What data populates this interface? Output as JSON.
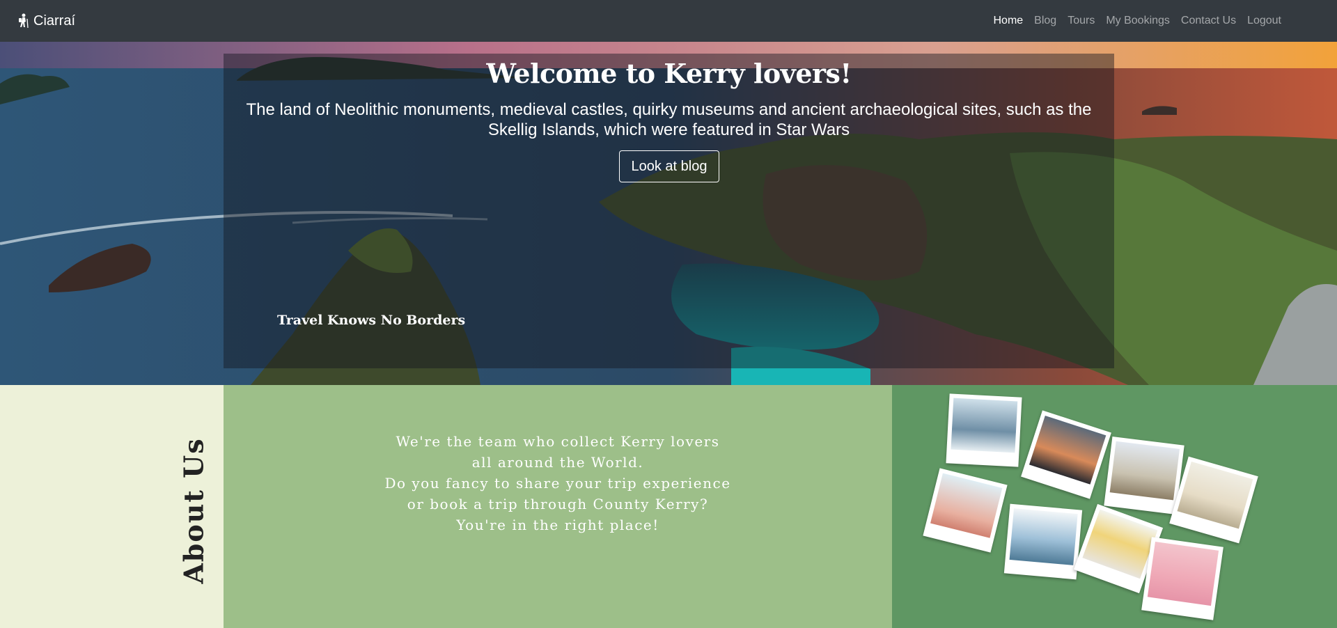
{
  "navbar": {
    "brand": "Ciarraí",
    "brand_icon": "hiker-icon",
    "links": [
      "Home",
      "Blog",
      "Tours",
      "My Bookings",
      "Contact Us",
      "Logout"
    ],
    "active_link": "Home"
  },
  "hero": {
    "title": "Welcome to Kerry lovers!",
    "subtitle_line1": "The land of Neolithic monuments, medieval castles, quirky museums and ancient archaeological sites, such as the",
    "subtitle_line2": "Skellig Islands, which were featured in Star Wars",
    "button": "Look at blog",
    "caption": "Travel Knows No Borders"
  },
  "about": {
    "heading": "About Us",
    "lines": [
      "We're the team who collect Kerry lovers",
      "all around the World.",
      "Do you fancy to share your trip experience",
      "or book a trip through County Kerry?",
      "You're in the right place!"
    ]
  },
  "colors": {
    "navbar": "#343a40",
    "about_left": "#edf1d9",
    "about_mid": "#9dbf89",
    "about_right": "#5f9763"
  }
}
